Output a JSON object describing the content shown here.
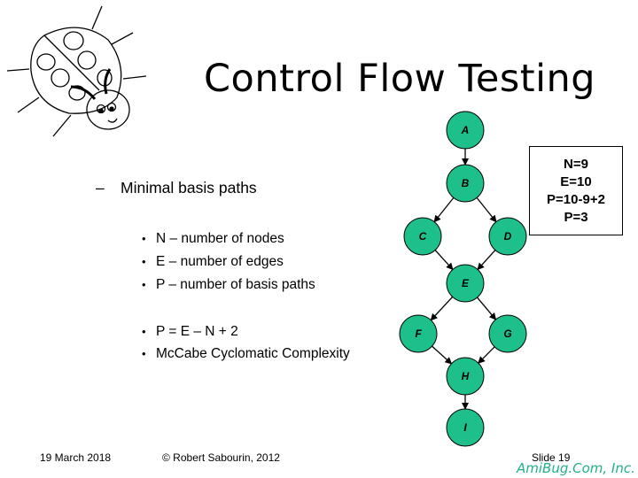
{
  "slide": {
    "title": "Control Flow Testing",
    "sub_bullet": {
      "marker": "–",
      "text": "Minimal basis paths"
    },
    "bullets_group1": [
      {
        "marker": "•",
        "text": "N – number of nodes"
      },
      {
        "marker": "•",
        "text": "E – number of edges"
      },
      {
        "marker": "•",
        "text": "P – number of basis paths"
      }
    ],
    "bullets_group2": [
      {
        "marker": "•",
        "text": "P = E – N + 2"
      },
      {
        "marker": "•",
        "text": "McCabe Cyclomatic Complexity"
      }
    ],
    "calc_box": {
      "lines": [
        "N=9",
        "E=10",
        "P=10-9+2",
        "P=3"
      ]
    },
    "graph": {
      "node_color": "#1dbf8a",
      "nodes": [
        "A",
        "B",
        "C",
        "D",
        "E",
        "F",
        "G",
        "H",
        "I"
      ],
      "edges": [
        [
          "A",
          "B"
        ],
        [
          "B",
          "C"
        ],
        [
          "B",
          "D"
        ],
        [
          "C",
          "E"
        ],
        [
          "D",
          "E"
        ],
        [
          "E",
          "F"
        ],
        [
          "E",
          "G"
        ],
        [
          "F",
          "H"
        ],
        [
          "G",
          "H"
        ],
        [
          "H",
          "I"
        ]
      ]
    },
    "footer": {
      "date": "19 March 2018",
      "copyright": "© Robert Sabourin, 2012",
      "slide_number": "Slide 19",
      "brand": "AmiBug.Com, Inc.",
      "brand_color": "#20b08a"
    },
    "logo_icon": "ladybug-icon"
  }
}
